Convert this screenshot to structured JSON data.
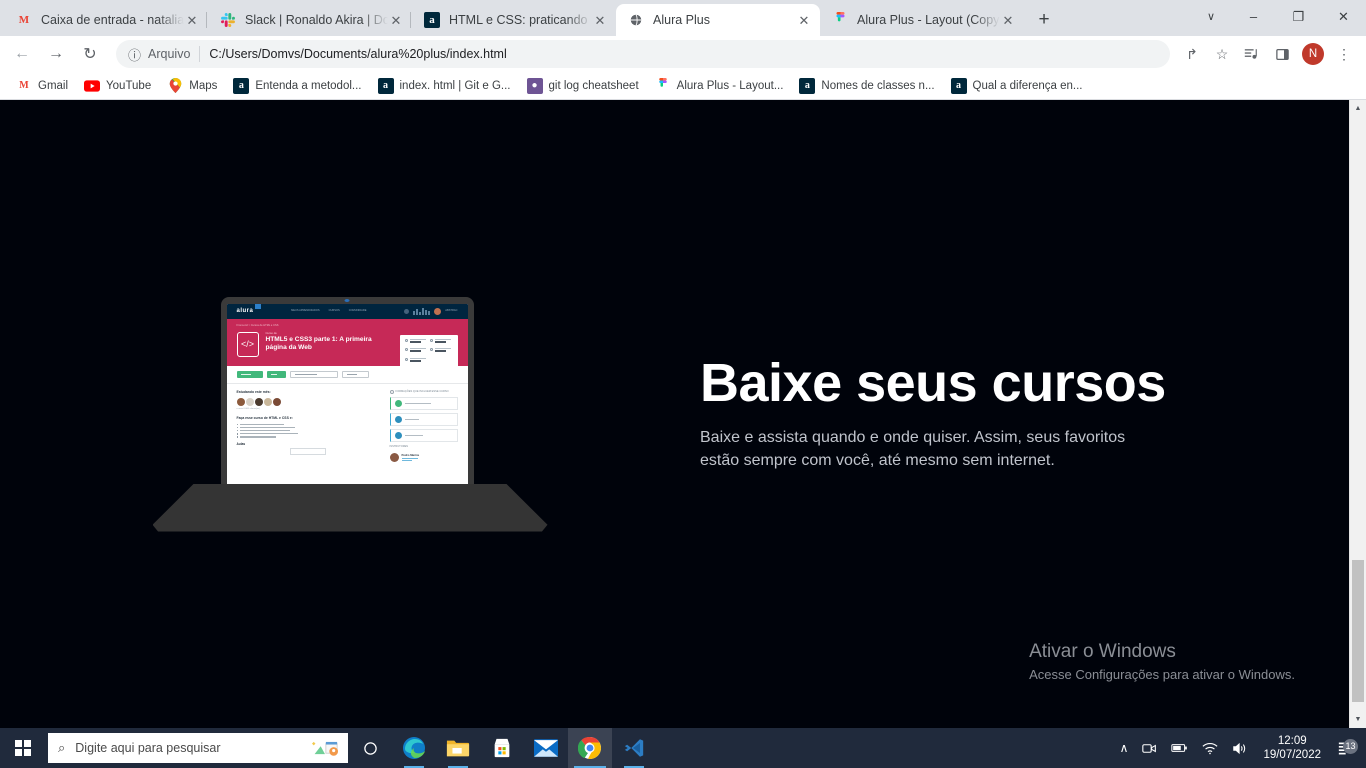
{
  "browser": {
    "tabs": [
      {
        "title": "Caixa de entrada - natalia.san",
        "favicon": "gmail-icon",
        "active": false
      },
      {
        "title": "Slack | Ronaldo Akira | Domvs",
        "favicon": "slack-icon",
        "active": false
      },
      {
        "title": "HTML e CSS: praticando HTM",
        "favicon": "alura-icon",
        "active": false
      },
      {
        "title": "Alura Plus",
        "favicon": "globe-icon",
        "active": true
      },
      {
        "title": "Alura Plus - Layout (Copy) – F",
        "favicon": "figma-icon",
        "active": false
      }
    ],
    "new_tab_label": "+",
    "close_label": "✕",
    "window_controls": {
      "chevron": "∨",
      "minimize": "–",
      "maximize": "❐",
      "close": "✕"
    },
    "toolbar": {
      "back": "←",
      "forward": "→",
      "reload": "↻",
      "omnibox_icon": "ⓘ",
      "omnibox_scheme": "Arquivo",
      "omnibox_url": "C:/Users/Domvs/Documents/alura%20plus/index.html",
      "share_icon": "↱",
      "bookmark_icon": "☆",
      "media_icon": "≡",
      "sidepanel_icon": "▣",
      "avatar_letter": "N",
      "menu_icon": "⋮"
    },
    "bookmarks": [
      {
        "label": "Gmail",
        "favicon": "gmail-icon"
      },
      {
        "label": "YouTube",
        "favicon": "youtube-icon"
      },
      {
        "label": "Maps",
        "favicon": "maps-icon"
      },
      {
        "label": "Entenda a metodol...",
        "favicon": "alura-icon"
      },
      {
        "label": "index. html | Git e G...",
        "favicon": "alura-icon"
      },
      {
        "label": "git log cheatsheet",
        "favicon": "git-icon"
      },
      {
        "label": "Alura Plus - Layout...",
        "favicon": "figma-icon"
      },
      {
        "label": "Nomes de classes n...",
        "favicon": "alura-icon"
      },
      {
        "label": "Qual a diferença en...",
        "favicon": "alura-icon"
      }
    ],
    "scrollbar": {
      "up_arrow": "▲",
      "down_arrow": "▼"
    }
  },
  "page": {
    "background_color": "#00030b",
    "hero": {
      "title": "Baixe seus cursos",
      "description": "Baixe e assista quando e onde quiser. Assim, seus favoritos estão sempre com você, até mesmo sem internet.",
      "image_alt": "notebook-alura-course"
    },
    "laptop_screen": {
      "brand": "alura",
      "nav_links": [
        "MEUS APRENDIZADOS",
        "CURSOS",
        "COMUNIDADE"
      ],
      "nav_user": "ABSTRAC",
      "breadcrumb": "Front-end > Cursos de HTML e CSS",
      "course_kicker": "Curso de",
      "course_title": "HTML5 e CSS3 parte 1: A primeira página da Web",
      "buttons": [
        "Iniciar Curso",
        "Baixar curso",
        "Adicionar a um Plano de Estudos",
        "Outras opções"
      ],
      "students_heading": "Estudando este mês:",
      "students_note": "e mais 6.000 alunos(as)",
      "learn_heading": "Faça esse curso de HTML e CSS e:",
      "learn_items": [
        "Aprenda o que é o HTML e o CSS",
        "Entenda a estrutura básica de um arquivo HTML",
        "Utilize o navegador para inspecionar elementos",
        "Aprenda a definir estilos para elementos usando o CSS",
        "Desenvolva sua página HTML"
      ],
      "aulas_heading": "Aulas",
      "related_heading": "FORMAÇÕES QUE INCLUEM ESSE CURSO",
      "related_items": [
        "Iniciante em Programação",
        "Front-end",
        "HTML e CSS"
      ],
      "instructor_heading": "INSTRUTORES",
      "instructor_name": "Pedro Marins",
      "accent_color": "#c62957",
      "nav_color": "#00253f"
    },
    "watermark": {
      "title": "Ativar o Windows",
      "subtitle": "Acesse Configurações para ativar o Windows."
    }
  },
  "taskbar": {
    "start_label": "start-menu",
    "search_placeholder": "Digite aqui para pesquisar",
    "search_icon": "⌕",
    "buttons": [
      {
        "name": "cortana",
        "label": "○"
      },
      {
        "name": "microsoft-edge",
        "label": "edge"
      },
      {
        "name": "file-explorer",
        "label": "folder"
      },
      {
        "name": "microsoft-store",
        "label": "store"
      },
      {
        "name": "mail",
        "label": "mail"
      },
      {
        "name": "google-chrome",
        "label": "chrome"
      },
      {
        "name": "visual-studio-code",
        "label": "vscode"
      }
    ],
    "tray": {
      "chevron": "∧",
      "recording": "⧉",
      "battery": "▭",
      "wifi": "◠",
      "volume": "◂",
      "time": "12:09",
      "date": "19/07/2022",
      "notification_count": "13"
    }
  }
}
